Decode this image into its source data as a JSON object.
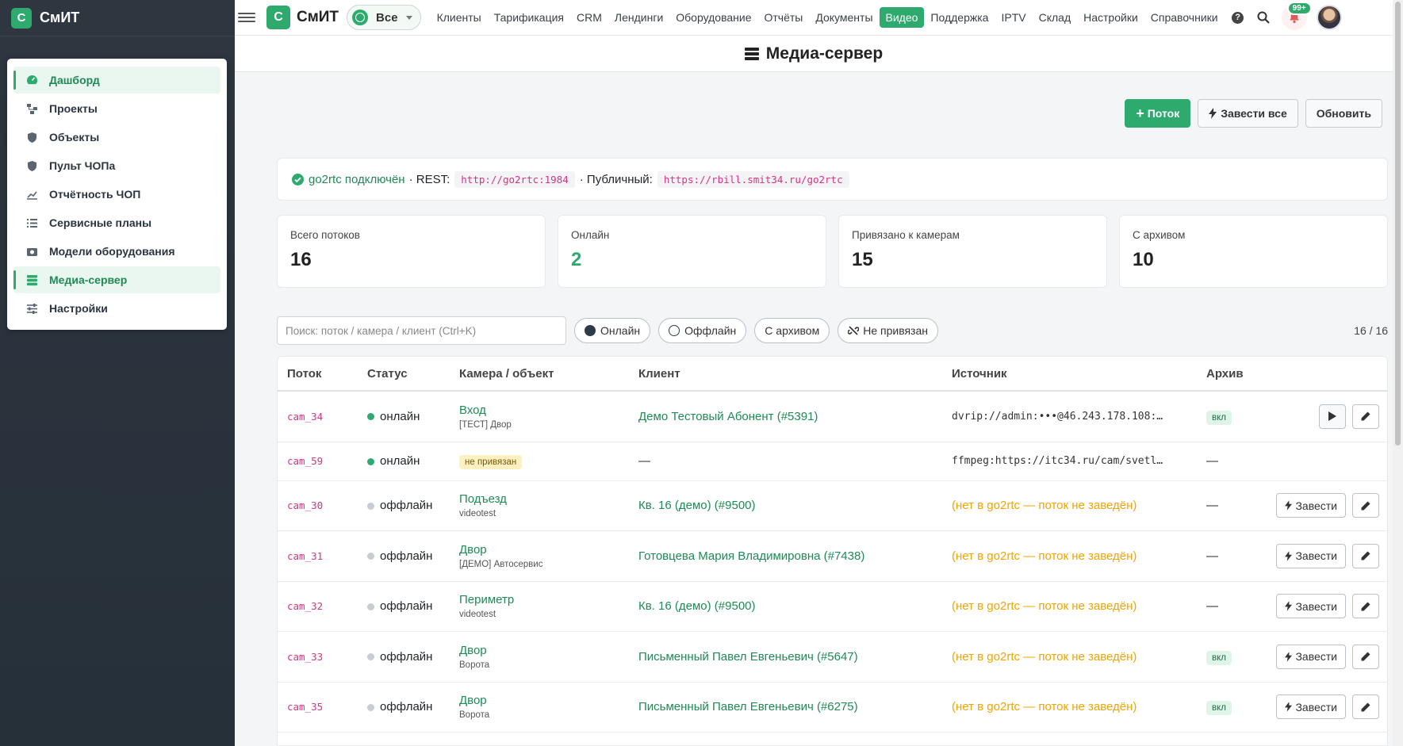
{
  "sidebar": {
    "brand": "СмИТ",
    "items": [
      {
        "label": "Дашборд",
        "icon": "dashboard-icon",
        "active": true
      },
      {
        "label": "Проекты",
        "icon": "projects-icon",
        "active": false
      },
      {
        "label": "Объекты",
        "icon": "shield-icon",
        "active": false
      },
      {
        "label": "Пульт ЧОПа",
        "icon": "shield-icon",
        "active": false
      },
      {
        "label": "Отчётность ЧОП",
        "icon": "chart-icon",
        "active": false
      },
      {
        "label": "Сервисные планы",
        "icon": "list-icon",
        "active": false
      },
      {
        "label": "Модели оборудования",
        "icon": "box-icon",
        "active": false
      },
      {
        "label": "Медиа-сервер",
        "icon": "server-icon",
        "active": true
      },
      {
        "label": "Настройки",
        "icon": "sliders-icon",
        "active": false
      }
    ]
  },
  "topbar": {
    "brand": "СмИТ",
    "logo_letter": "С",
    "selector": "Все",
    "nav": [
      "Клиенты",
      "Тарификация",
      "CRM",
      "Лендинги",
      "Оборудование",
      "Отчёты",
      "Документы",
      "Видео",
      "Поддержка",
      "IPTV",
      "Склад",
      "Настройки",
      "Справочники"
    ],
    "active_nav": "Видео",
    "notif_badge": "99+"
  },
  "page": {
    "title": "Медиа-сервер",
    "buttons": {
      "add": "Поток",
      "start_all": "Завести все",
      "refresh": "Обновить"
    }
  },
  "info": {
    "status": "go2rtc подключён",
    "rest_label": "· REST:",
    "rest_url": "http://go2rtc:1984",
    "public_label": "· Публичный:",
    "public_url": "https://rbill.smit34.ru/go2rtc"
  },
  "stats": [
    {
      "label": "Всего потоков",
      "value": "16"
    },
    {
      "label": "Онлайн",
      "value": "2"
    },
    {
      "label": "Привязано к камерам",
      "value": "15"
    },
    {
      "label": "С архивом",
      "value": "10"
    }
  ],
  "filters": {
    "search_placeholder": "Поиск: поток / камера / клиент (Ctrl+K)",
    "chips": [
      "Онлайн",
      "Оффлайн",
      "С архивом",
      "Не привязан"
    ],
    "counter": "16 / 16"
  },
  "table": {
    "headers": [
      "Поток",
      "Статус",
      "Камера / объект",
      "Клиент",
      "Источник",
      "Архив"
    ],
    "rows": [
      {
        "stream": "cam_34",
        "status": "онлайн",
        "cam": "Вход",
        "cam_sub": "[ТЕСТ] Двор",
        "client": "Демо Тестовый Абонент (#5391)",
        "source": "dvrip://admin:•••@46.243.178.108:…",
        "archive": "вкл",
        "actions": "play"
      },
      {
        "stream": "cam_59",
        "status": "онлайн",
        "cam_tag": "не привязан",
        "client": "—",
        "source": "ffmpeg:https://itc34.ru/cam/svetl…",
        "archive": "—",
        "actions": "none"
      },
      {
        "stream": "cam_30",
        "status": "оффлайн",
        "cam": "Подъезд",
        "cam_sub": "videotest",
        "client": "Кв. 16 (демо) (#9500)",
        "source": "(нет в go2rtc — поток не заведён)",
        "archive": "—",
        "actions": "start"
      },
      {
        "stream": "cam_31",
        "status": "оффлайн",
        "cam": "Двор",
        "cam_sub": "[ДЕМО] Автосервис",
        "client": "Готовцева Мария Владимировна (#7438)",
        "source": "(нет в go2rtc — поток не заведён)",
        "archive": "—",
        "actions": "start"
      },
      {
        "stream": "cam_32",
        "status": "оффлайн",
        "cam": "Периметр",
        "cam_sub": "videotest",
        "client": "Кв. 16 (демо) (#9500)",
        "source": "(нет в go2rtc — поток не заведён)",
        "archive": "—",
        "actions": "start"
      },
      {
        "stream": "cam_33",
        "status": "оффлайн",
        "cam": "Двор",
        "cam_sub": "Ворота",
        "client": "Письменный Павел Евгеньевич (#5647)",
        "source": "(нет в go2rtc — поток не заведён)",
        "archive": "вкл",
        "actions": "start"
      },
      {
        "stream": "cam_35",
        "status": "оффлайн",
        "cam": "Двор",
        "cam_sub": "Ворота",
        "client": "Письменный Павел Евгеньевич (#6275)",
        "source": "(нет в go2rtc — поток не заведён)",
        "archive": "вкл",
        "actions": "start"
      }
    ],
    "start_label": "Завести"
  },
  "colors": {
    "accent": "#2eaa6e",
    "warn": "#f0a500",
    "pink": "#d63384",
    "sidebar_bg": "#2e3640"
  }
}
